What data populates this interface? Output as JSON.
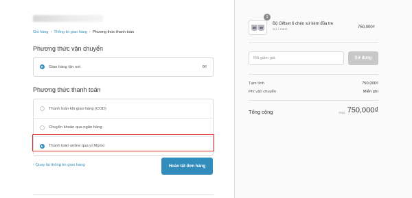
{
  "breadcrumb": {
    "cart": "Giỏ hàng",
    "shipping_info": "Thông tin giao hàng",
    "current": "Phương thức thanh toán",
    "separator": "›"
  },
  "shipping": {
    "title": "Phương thức vận chuyển",
    "option_label": "Giao hàng tận nơi",
    "option_price": "0₫"
  },
  "payment": {
    "title": "Phương thức thanh toán",
    "options": [
      {
        "label": "Thanh toán khi giao hàng (COD)",
        "selected": false
      },
      {
        "label": "Chuyển khoản qua ngân hàng",
        "selected": false
      },
      {
        "label": "Thanh toán online qua ví Momo",
        "selected": true
      }
    ]
  },
  "actions": {
    "back_label": "‹  Quay lại thông tin giao hàng",
    "complete_label": "Hoàn tất đơn hàng"
  },
  "order": {
    "quantity": "1",
    "product_name": "Bộ Giftset 6 chén sứ kèm đũa tre",
    "product_variant": "Sứ / Xanh",
    "product_price": "750,000₫"
  },
  "coupon": {
    "placeholder": "Mã giảm giá",
    "button_label": "Sử dụng"
  },
  "summary": {
    "subtotal_label": "Tạm tính",
    "subtotal_value": "750,000₫",
    "shipping_label": "Phí vận chuyển",
    "shipping_value": "Miễn phí",
    "total_label": "Tổng cộng",
    "currency": "VND",
    "total_value": "750,000₫"
  },
  "colors": {
    "accent": "#338dbc",
    "highlight": "#e02b2b",
    "disabled_button": "#c8c8c8"
  }
}
